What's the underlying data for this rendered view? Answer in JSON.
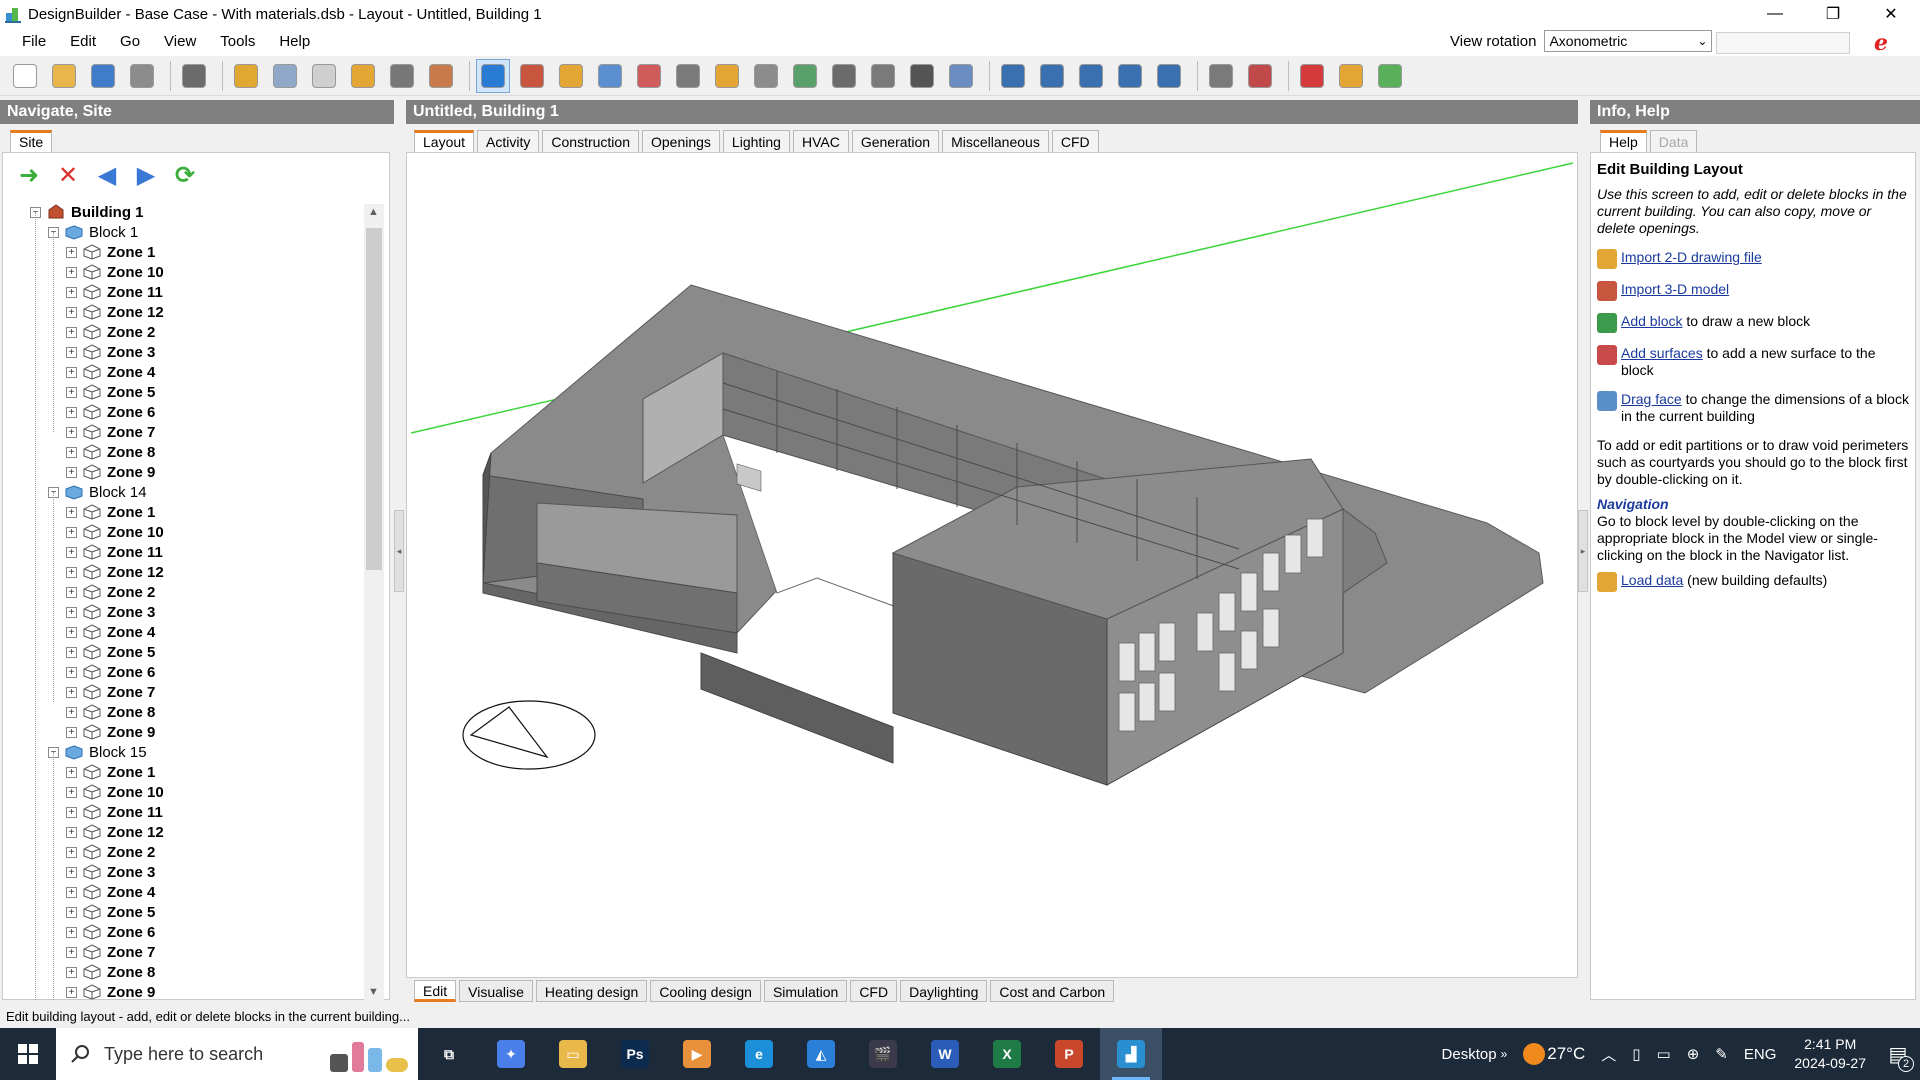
{
  "window": {
    "title": "DesignBuilder - Base Case - With materials.dsb - Layout - Untitled, Building 1",
    "minimize": "—",
    "restore": "❐",
    "close": "✕"
  },
  "menu": [
    "File",
    "Edit",
    "Go",
    "View",
    "Tools",
    "Help"
  ],
  "view_rotation": {
    "label": "View rotation",
    "value": "Axonometric"
  },
  "toolbar_icons": [
    {
      "name": "new-file-icon",
      "color": "#ffffff"
    },
    {
      "name": "open-folder-icon",
      "color": "#e8b64a"
    },
    {
      "name": "save-icon",
      "color": "#3f7cc9"
    },
    {
      "name": "print-icon",
      "color": "#8c8c8c"
    },
    {
      "name": "edit-icon",
      "color": "#6b6b6b"
    },
    {
      "name": "wrench-icon",
      "color": "#e0a830"
    },
    {
      "name": "table-icon",
      "color": "#8fa8c8"
    },
    {
      "name": "eraser-icon",
      "color": "#cfcfcf"
    },
    {
      "name": "import-icon",
      "color": "#e3a534"
    },
    {
      "name": "copy-icon",
      "color": "#777777"
    },
    {
      "name": "globe-icon",
      "color": "#c97a4a"
    },
    {
      "name": "select-arrow-icon",
      "color": "#2a7bd4"
    },
    {
      "name": "import-3d-icon",
      "color": "#c8553d"
    },
    {
      "name": "import-2d-icon",
      "color": "#e3a534"
    },
    {
      "name": "add-block-icon",
      "color": "#5b8fd0"
    },
    {
      "name": "add-surface-icon",
      "color": "#d05b5b"
    },
    {
      "name": "drag-face-icon",
      "color": "#7a7a7a"
    },
    {
      "name": "measure-icon",
      "color": "#e3a534"
    },
    {
      "name": "rotate-icon",
      "color": "#8c8c8c"
    },
    {
      "name": "move-block-icon",
      "color": "#5aa06a"
    },
    {
      "name": "paint-icon",
      "color": "#6b6b6b"
    },
    {
      "name": "mirror-icon",
      "color": "#7a7a7a"
    },
    {
      "name": "pencil-icon",
      "color": "#555555"
    },
    {
      "name": "drawing-guide-icon",
      "color": "#6a8cc0"
    },
    {
      "name": "orbit-icon",
      "color": "#3a6fb0"
    },
    {
      "name": "zoom-in-icon",
      "color": "#3a6fb0"
    },
    {
      "name": "zoom-window-icon",
      "color": "#3a6fb0"
    },
    {
      "name": "pan-icon",
      "color": "#3a6fb0"
    },
    {
      "name": "zoom-extents-icon",
      "color": "#3a6fb0"
    },
    {
      "name": "report-icon",
      "color": "#7a7a7a"
    },
    {
      "name": "model-data-icon",
      "color": "#c04a4a"
    },
    {
      "name": "check-icon",
      "color": "#d43a3a"
    },
    {
      "name": "settings-icon",
      "color": "#e3a534"
    },
    {
      "name": "lca-icon",
      "color": "#5ab05a"
    }
  ],
  "left_panel": {
    "title": "Navigate, Site",
    "tabs": [
      "Site"
    ],
    "tools": [
      {
        "name": "go-icon",
        "color": "#3cae3c",
        "glyph": "➜"
      },
      {
        "name": "delete-icon",
        "color": "#d33",
        "glyph": "✕"
      },
      {
        "name": "back-icon",
        "color": "#3a78d6",
        "glyph": "◀"
      },
      {
        "name": "forward-icon",
        "color": "#3a78d6",
        "glyph": "▶"
      },
      {
        "name": "refresh-icon",
        "color": "#3cae3c",
        "glyph": "⟳"
      }
    ],
    "tree": {
      "building": "Building 1",
      "blocks": [
        {
          "name": "Block 1",
          "zones": [
            "Zone 1",
            "Zone 10",
            "Zone 11",
            "Zone 12",
            "Zone 2",
            "Zone 3",
            "Zone 4",
            "Zone 5",
            "Zone 6",
            "Zone 7",
            "Zone 8",
            "Zone 9"
          ]
        },
        {
          "name": "Block 14",
          "zones": [
            "Zone 1",
            "Zone 10",
            "Zone 11",
            "Zone 12",
            "Zone 2",
            "Zone 3",
            "Zone 4",
            "Zone 5",
            "Zone 6",
            "Zone 7",
            "Zone 8",
            "Zone 9"
          ]
        },
        {
          "name": "Block 15",
          "zones": [
            "Zone 1",
            "Zone 10",
            "Zone 11",
            "Zone 12",
            "Zone 2",
            "Zone 3",
            "Zone 4",
            "Zone 5",
            "Zone 6",
            "Zone 7",
            "Zone 8",
            "Zone 9"
          ]
        }
      ]
    }
  },
  "center_panel": {
    "title": "Untitled, Building 1",
    "tabs": [
      "Layout",
      "Activity",
      "Construction",
      "Openings",
      "Lighting",
      "HVAC",
      "Generation",
      "Miscellaneous",
      "CFD"
    ],
    "bottom_tabs": [
      "Edit",
      "Visualise",
      "Heating design",
      "Cooling design",
      "Simulation",
      "CFD",
      "Daylighting",
      "Cost and Carbon"
    ]
  },
  "right_panel": {
    "title": "Info, Help",
    "tabs": [
      "Help",
      "Data"
    ],
    "heading": "Edit Building Layout",
    "intro": "Use this screen to add, edit or delete blocks in the current building. You can also copy, move or delete openings.",
    "items": [
      {
        "icon": "import-2d-icon",
        "color": "#e3a534",
        "link": "Import 2-D drawing file",
        "text": ""
      },
      {
        "icon": "import-3d-icon",
        "color": "#c8553d",
        "link": "Import 3-D model",
        "text": ""
      },
      {
        "icon": "add-block-icon",
        "color": "#3c9a4c",
        "link": "Add block",
        "text": " to draw a new block"
      },
      {
        "icon": "add-surface-icon",
        "color": "#c84a4a",
        "link": "Add surfaces",
        "text": " to add a new surface to the block"
      },
      {
        "icon": "drag-face-icon",
        "color": "#5a8fc8",
        "link": "Drag face",
        "text": " to change the dimensions of a block in the current building"
      }
    ],
    "partitions_text": "To add or edit partitions or to draw void perimeters such as courtyards you should go to the block first by double-clicking on it.",
    "nav_heading": "Navigation",
    "nav_text": "Go to block level by double-clicking on the appropriate block in the Model view or single-clicking on the block in the Navigator list.",
    "load_item": {
      "icon": "load-data-icon",
      "color": "#e3a534",
      "link": "Load data",
      "text": " (new building defaults)"
    }
  },
  "status_text": "Edit building layout - add, edit or delete blocks in the current building...",
  "taskbar": {
    "search_placeholder": "Type here to search",
    "apps": [
      {
        "name": "task-view-icon",
        "label": "⧉",
        "color": "#1c2a3a"
      },
      {
        "name": "copilot-icon",
        "label": "✦",
        "color": "#4a7ee8"
      },
      {
        "name": "file-explorer-icon",
        "label": "▭",
        "color": "#e8b84a"
      },
      {
        "name": "photoshop-icon",
        "label": "Ps",
        "color": "#0d2b4e"
      },
      {
        "name": "media-player-icon",
        "label": "▶",
        "color": "#e8903a"
      },
      {
        "name": "edge-icon",
        "label": "e",
        "color": "#1b8fd8"
      },
      {
        "name": "photos-icon",
        "label": "◭",
        "color": "#2b7fd8"
      },
      {
        "name": "clipchamp-icon",
        "label": "🎬",
        "color": "#3a3a4a"
      },
      {
        "name": "word-icon",
        "label": "W",
        "color": "#2b5cb8"
      },
      {
        "name": "excel-icon",
        "label": "X",
        "color": "#1e7b45"
      },
      {
        "name": "powerpoint-icon",
        "label": "P",
        "color": "#c9472a"
      },
      {
        "name": "designbuilder-icon",
        "label": "▟",
        "color": "#2a8fd0"
      }
    ],
    "desktop_label": "Desktop",
    "temperature": "27°C",
    "language": "ENG",
    "time": "2:41 PM",
    "date": "2024-09-27",
    "notification_count": "2"
  }
}
